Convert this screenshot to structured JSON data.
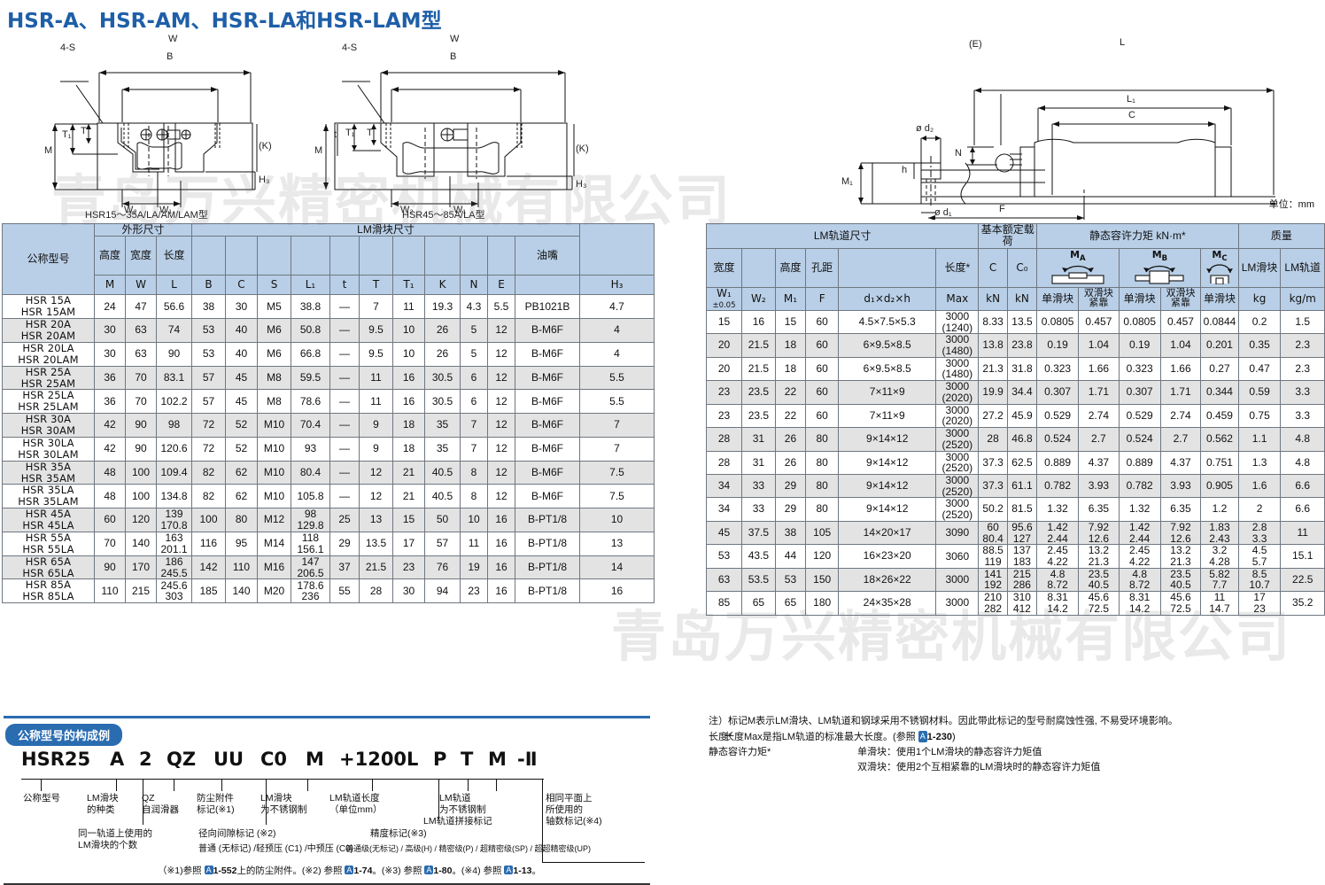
{
  "page": {
    "title": "HSR-A、HSR-AM、HSR-LA和HSR-LAM型",
    "unit_note": "单位：mm"
  },
  "diagrams": {
    "left_caption": "HSR15～35A/LA/AM/LAM型",
    "right_caption": "HSR45～85A/LA型",
    "labels": {
      "four_s": "4-S",
      "W": "W",
      "B": "B",
      "M": "M",
      "T": "T",
      "T1": "T₁",
      "t": "t",
      "K": "(K)",
      "H3": "H₃",
      "W1": "W₁",
      "W2": "W₂",
      "E": "(E)",
      "L": "L",
      "L1": "L₁",
      "C": "C",
      "N": "N",
      "d1": "ø d₁",
      "d2": "ø d₂",
      "h": "h",
      "M1": "M₁",
      "F": "F"
    }
  },
  "watermark": {
    "line1": "青岛万兴精密机械有限公司",
    "line2": "青岛万兴精密机械有限公司"
  },
  "left_table": {
    "group_headers": {
      "model": "公称型号",
      "outline": "外形尺寸",
      "block": "LM滑块尺寸"
    },
    "sub_headers": {
      "height": "高度",
      "width": "宽度",
      "length": "长度",
      "nipple": "油嘴"
    },
    "symbols": [
      "M",
      "W",
      "L",
      "B",
      "C",
      "S",
      "L₁",
      "t",
      "T",
      "T₁",
      "K",
      "N",
      "E",
      "",
      "H₃"
    ],
    "rows": [
      {
        "model": [
          "HSR  15A",
          "HSR  15AM"
        ],
        "M": "24",
        "W": "47",
        "L": "56.6",
        "B": "38",
        "C": "30",
        "S": "M5",
        "L1": "38.8",
        "t": "—",
        "T": "7",
        "T1": "11",
        "K": "19.3",
        "N": "4.3",
        "E": "5.5",
        "nipple": "PB1021B",
        "H3": "4.7"
      },
      {
        "model": [
          "HSR  20A",
          "HSR  20AM"
        ],
        "M": "30",
        "W": "63",
        "L": "74",
        "B": "53",
        "C": "40",
        "S": "M6",
        "L1": "50.8",
        "t": "—",
        "T": "9.5",
        "T1": "10",
        "K": "26",
        "N": "5",
        "E": "12",
        "nipple": "B-M6F",
        "H3": "4"
      },
      {
        "model": [
          "HSR  20LA",
          "HSR  20LAM"
        ],
        "M": "30",
        "W": "63",
        "L": "90",
        "B": "53",
        "C": "40",
        "S": "M6",
        "L1": "66.8",
        "t": "—",
        "T": "9.5",
        "T1": "10",
        "K": "26",
        "N": "5",
        "E": "12",
        "nipple": "B-M6F",
        "H3": "4"
      },
      {
        "model": [
          "HSR  25A",
          "HSR  25AM"
        ],
        "M": "36",
        "W": "70",
        "L": "83.1",
        "B": "57",
        "C": "45",
        "S": "M8",
        "L1": "59.5",
        "t": "—",
        "T": "11",
        "T1": "16",
        "K": "30.5",
        "N": "6",
        "E": "12",
        "nipple": "B-M6F",
        "H3": "5.5"
      },
      {
        "model": [
          "HSR  25LA",
          "HSR  25LAM"
        ],
        "M": "36",
        "W": "70",
        "L": "102.2",
        "B": "57",
        "C": "45",
        "S": "M8",
        "L1": "78.6",
        "t": "—",
        "T": "11",
        "T1": "16",
        "K": "30.5",
        "N": "6",
        "E": "12",
        "nipple": "B-M6F",
        "H3": "5.5"
      },
      {
        "model": [
          "HSR  30A",
          "HSR  30AM"
        ],
        "M": "42",
        "W": "90",
        "L": "98",
        "B": "72",
        "C": "52",
        "S": "M10",
        "L1": "70.4",
        "t": "—",
        "T": "9",
        "T1": "18",
        "K": "35",
        "N": "7",
        "E": "12",
        "nipple": "B-M6F",
        "H3": "7"
      },
      {
        "model": [
          "HSR  30LA",
          "HSR  30LAM"
        ],
        "M": "42",
        "W": "90",
        "L": "120.6",
        "B": "72",
        "C": "52",
        "S": "M10",
        "L1": "93",
        "t": "—",
        "T": "9",
        "T1": "18",
        "K": "35",
        "N": "7",
        "E": "12",
        "nipple": "B-M6F",
        "H3": "7"
      },
      {
        "model": [
          "HSR  35A",
          "HSR  35AM"
        ],
        "M": "48",
        "W": "100",
        "L": "109.4",
        "B": "82",
        "C": "62",
        "S": "M10",
        "L1": "80.4",
        "t": "—",
        "T": "12",
        "T1": "21",
        "K": "40.5",
        "N": "8",
        "E": "12",
        "nipple": "B-M6F",
        "H3": "7.5"
      },
      {
        "model": [
          "HSR  35LA",
          "HSR  35LAM"
        ],
        "M": "48",
        "W": "100",
        "L": "134.8",
        "B": "82",
        "C": "62",
        "S": "M10",
        "L1": "105.8",
        "t": "—",
        "T": "12",
        "T1": "21",
        "K": "40.5",
        "N": "8",
        "E": "12",
        "nipple": "B-M6F",
        "H3": "7.5"
      },
      {
        "model": [
          "HSR  45A",
          "HSR  45LA"
        ],
        "M": "60",
        "W": "120",
        "L": [
          "139",
          "170.8"
        ],
        "B": "100",
        "C": "80",
        "S": "M12",
        "L1": [
          "98",
          "129.8"
        ],
        "t": "25",
        "T": "13",
        "T1": "15",
        "K": "50",
        "N": "10",
        "E": "16",
        "nipple": "B-PT1/8",
        "H3": "10"
      },
      {
        "model": [
          "HSR  55A",
          "HSR  55LA"
        ],
        "M": "70",
        "W": "140",
        "L": [
          "163",
          "201.1"
        ],
        "B": "116",
        "C": "95",
        "S": "M14",
        "L1": [
          "118",
          "156.1"
        ],
        "t": "29",
        "T": "13.5",
        "T1": "17",
        "K": "57",
        "N": "11",
        "E": "16",
        "nipple": "B-PT1/8",
        "H3": "13"
      },
      {
        "model": [
          "HSR  65A",
          "HSR  65LA"
        ],
        "M": "90",
        "W": "170",
        "L": [
          "186",
          "245.5"
        ],
        "B": "142",
        "C": "110",
        "S": "M16",
        "L1": [
          "147",
          "206.5"
        ],
        "t": "37",
        "T": "21.5",
        "T1": "23",
        "K": "76",
        "N": "19",
        "E": "16",
        "nipple": "B-PT1/8",
        "H3": "14"
      },
      {
        "model": [
          "HSR  85A",
          "HSR  85LA"
        ],
        "M": "110",
        "W": "215",
        "L": [
          "245.6",
          "303"
        ],
        "B": "185",
        "C": "140",
        "S": "M20",
        "L1": [
          "178.6",
          "236"
        ],
        "t": "55",
        "T": "28",
        "T1": "30",
        "K": "94",
        "N": "23",
        "E": "16",
        "nipple": "B-PT1/8",
        "H3": "16"
      }
    ]
  },
  "right_table": {
    "group_headers": {
      "rail": "LM轨道尺寸",
      "load": "基本额定载荷",
      "moment": "静态容许力矩 kN·m*",
      "mass": "质量"
    },
    "sub_headers": {
      "width": "宽度",
      "height": "高度",
      "pitch": "孔距",
      "length": "长度*",
      "block_mass": "LM滑块",
      "rail_mass": "LM轨道",
      "single": "单滑块",
      "double": "双滑块\n紧靠"
    },
    "symbols": {
      "W1": "W₁",
      "W1_tol": "±0.05",
      "W2": "W₂",
      "M1": "M₁",
      "F": "F",
      "dims": "d₁×d₂×h",
      "max": "Max",
      "C": "C",
      "C0": "C₀",
      "C_unit": "kN",
      "C0_unit": "kN",
      "MA": "M",
      "MA_sub": "A",
      "MB": "M",
      "MB_sub": "B",
      "MC": "M",
      "MC_sub": "C",
      "kg": "kg",
      "kgm": "kg/m"
    },
    "rows": [
      {
        "W1": "15",
        "W2": "16",
        "M1": "15",
        "F": "60",
        "dims": "4.5×7.5×5.3",
        "Max": [
          "3000",
          "(1240)"
        ],
        "C": "8.33",
        "C0": "13.5",
        "MA1": "0.0805",
        "MA2": "0.457",
        "MB1": "0.0805",
        "MB2": "0.457",
        "MC": "0.0844",
        "mb": "0.2",
        "mr": "1.5"
      },
      {
        "W1": "20",
        "W2": "21.5",
        "M1": "18",
        "F": "60",
        "dims": "6×9.5×8.5",
        "Max": [
          "3000",
          "(1480)"
        ],
        "C": "13.8",
        "C0": "23.8",
        "MA1": "0.19",
        "MA2": "1.04",
        "MB1": "0.19",
        "MB2": "1.04",
        "MC": "0.201",
        "mb": "0.35",
        "mr": "2.3"
      },
      {
        "W1": "20",
        "W2": "21.5",
        "M1": "18",
        "F": "60",
        "dims": "6×9.5×8.5",
        "Max": [
          "3000",
          "(1480)"
        ],
        "C": "21.3",
        "C0": "31.8",
        "MA1": "0.323",
        "MA2": "1.66",
        "MB1": "0.323",
        "MB2": "1.66",
        "MC": "0.27",
        "mb": "0.47",
        "mr": "2.3"
      },
      {
        "W1": "23",
        "W2": "23.5",
        "M1": "22",
        "F": "60",
        "dims": "7×11×9",
        "Max": [
          "3000",
          "(2020)"
        ],
        "C": "19.9",
        "C0": "34.4",
        "MA1": "0.307",
        "MA2": "1.71",
        "MB1": "0.307",
        "MB2": "1.71",
        "MC": "0.344",
        "mb": "0.59",
        "mr": "3.3"
      },
      {
        "W1": "23",
        "W2": "23.5",
        "M1": "22",
        "F": "60",
        "dims": "7×11×9",
        "Max": [
          "3000",
          "(2020)"
        ],
        "C": "27.2",
        "C0": "45.9",
        "MA1": "0.529",
        "MA2": "2.74",
        "MB1": "0.529",
        "MB2": "2.74",
        "MC": "0.459",
        "mb": "0.75",
        "mr": "3.3"
      },
      {
        "W1": "28",
        "W2": "31",
        "M1": "26",
        "F": "80",
        "dims": "9×14×12",
        "Max": [
          "3000",
          "(2520)"
        ],
        "C": "28",
        "C0": "46.8",
        "MA1": "0.524",
        "MA2": "2.7",
        "MB1": "0.524",
        "MB2": "2.7",
        "MC": "0.562",
        "mb": "1.1",
        "mr": "4.8"
      },
      {
        "W1": "28",
        "W2": "31",
        "M1": "26",
        "F": "80",
        "dims": "9×14×12",
        "Max": [
          "3000",
          "(2520)"
        ],
        "C": "37.3",
        "C0": "62.5",
        "MA1": "0.889",
        "MA2": "4.37",
        "MB1": "0.889",
        "MB2": "4.37",
        "MC": "0.751",
        "mb": "1.3",
        "mr": "4.8"
      },
      {
        "W1": "34",
        "W2": "33",
        "M1": "29",
        "F": "80",
        "dims": "9×14×12",
        "Max": [
          "3000",
          "(2520)"
        ],
        "C": "37.3",
        "C0": "61.1",
        "MA1": "0.782",
        "MA2": "3.93",
        "MB1": "0.782",
        "MB2": "3.93",
        "MC": "0.905",
        "mb": "1.6",
        "mr": "6.6"
      },
      {
        "W1": "34",
        "W2": "33",
        "M1": "29",
        "F": "80",
        "dims": "9×14×12",
        "Max": [
          "3000",
          "(2520)"
        ],
        "C": "50.2",
        "C0": "81.5",
        "MA1": "1.32",
        "MA2": "6.35",
        "MB1": "1.32",
        "MB2": "6.35",
        "MC": "1.2",
        "mb": "2",
        "mr": "6.6"
      },
      {
        "W1": "45",
        "W2": "37.5",
        "M1": "38",
        "F": "105",
        "dims": "14×20×17",
        "Max": [
          "3090"
        ],
        "C": [
          "60",
          "80.4"
        ],
        "C0": [
          "95.6",
          "127"
        ],
        "MA1": [
          "1.42",
          "2.44"
        ],
        "MA2": [
          "7.92",
          "12.6"
        ],
        "MB1": [
          "1.42",
          "2.44"
        ],
        "MB2": [
          "7.92",
          "12.6"
        ],
        "MC": [
          "1.83",
          "2.43"
        ],
        "mb": [
          "2.8",
          "3.3"
        ],
        "mr": "11"
      },
      {
        "W1": "53",
        "W2": "43.5",
        "M1": "44",
        "F": "120",
        "dims": "16×23×20",
        "Max": [
          "3060"
        ],
        "C": [
          "88.5",
          "119"
        ],
        "C0": [
          "137",
          "183"
        ],
        "MA1": [
          "2.45",
          "4.22"
        ],
        "MA2": [
          "13.2",
          "21.3"
        ],
        "MB1": [
          "2.45",
          "4.22"
        ],
        "MB2": [
          "13.2",
          "21.3"
        ],
        "MC": [
          "3.2",
          "4.28"
        ],
        "mb": [
          "4.5",
          "5.7"
        ],
        "mr": "15.1"
      },
      {
        "W1": "63",
        "W2": "53.5",
        "M1": "53",
        "F": "150",
        "dims": "18×26×22",
        "Max": [
          "3000"
        ],
        "C": [
          "141",
          "192"
        ],
        "C0": [
          "215",
          "286"
        ],
        "MA1": [
          "4.8",
          "8.72"
        ],
        "MA2": [
          "23.5",
          "40.5"
        ],
        "MB1": [
          "4.8",
          "8.72"
        ],
        "MB2": [
          "23.5",
          "40.5"
        ],
        "MC": [
          "5.82",
          "7.7"
        ],
        "mb": [
          "8.5",
          "10.7"
        ],
        "mr": "22.5"
      },
      {
        "W1": "85",
        "W2": "65",
        "M1": "65",
        "F": "180",
        "dims": "24×35×28",
        "Max": [
          "3000"
        ],
        "C": [
          "210",
          "282"
        ],
        "C0": [
          "310",
          "412"
        ],
        "MA1": [
          "8.31",
          "14.2"
        ],
        "MA2": [
          "45.6",
          "72.5"
        ],
        "MB1": [
          "8.31",
          "14.2"
        ],
        "MB2": [
          "45.6",
          "72.5"
        ],
        "MC": [
          "11",
          "14.7"
        ],
        "mb": [
          "17",
          "23"
        ],
        "mr": "35.2"
      }
    ]
  },
  "notes": {
    "n1": "注）标记M表示LM滑块、LM轨道和钢球采用不锈钢材料。因此带此标记的型号耐腐蚀性强, 不易受环境影响。",
    "n2_label": "长度*",
    "n2_text": "长度Max是指LM轨道的标准最大长度。(参照  1-230)",
    "n3_label": "静态容许力矩*",
    "n3_a": "单滑块：使用1个LM滑块的静态容许力矩值",
    "n3_b": "双滑块：使用2个互相紧靠的LM滑块时的静态容许力矩值"
  },
  "designation": {
    "heading": "公称型号的构成例",
    "tokens": [
      "HSR25",
      "A",
      "2",
      "QZ",
      "UU",
      "C0",
      "M",
      "+1200L",
      "P",
      "T",
      "M",
      "-Ⅱ"
    ],
    "legends": {
      "model": "公称型号",
      "block_type": "LM滑块\n的种类",
      "qz": "QZ\n自润滑器",
      "dust": "防尘附件\n标记(※1)",
      "block_ss": "LM滑块\n为不锈钢制",
      "rail_len": "LM轨道长度\n（单位mm）",
      "rail_ss": "LM轨道\n为不锈钢制",
      "axis_count": "相同平面上\n所使用的\n轴数标记(※4)",
      "block_count": "同一轨道上使用的\nLM滑块的个数",
      "clearance": "径向间隙标记 (※2)",
      "clearance_sub": "普通 (无标记) /轻预压 (C1) /中预压 (C0)",
      "accuracy": "精度标记(※3)",
      "accuracy_sub": "普通级(无标记) / 高级(H) / 精密级(P) / 超精密级(SP) / 超超精密级(UP)",
      "joint": "LM轨道拼接标记"
    },
    "footnote": "（※1)参照 1-552上的防尘附件。(※2) 参照 1-74。(※3) 参照 1-80。(※4) 参照 1-13。"
  }
}
